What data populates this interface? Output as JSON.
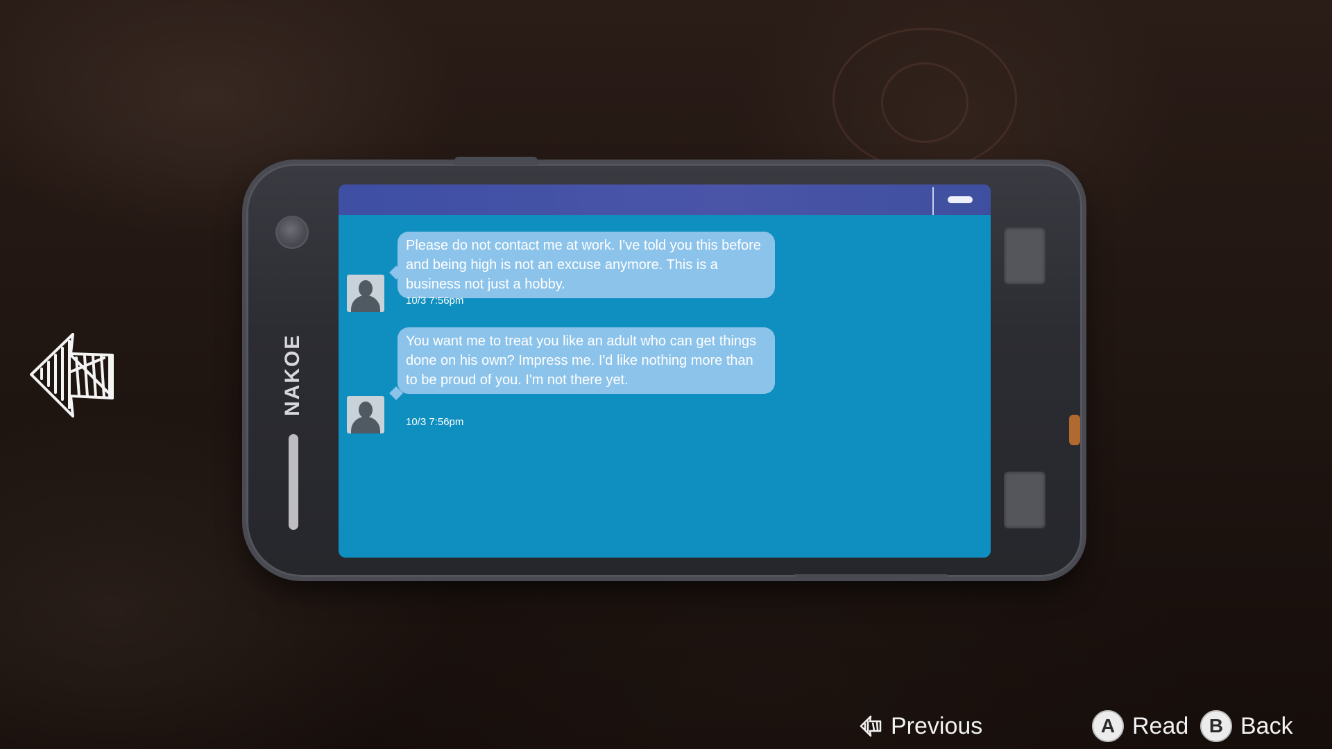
{
  "phone": {
    "brand": "NAKOE"
  },
  "messages": [
    {
      "text": "Please do not contact me at work. I've told you this before and being high is not an excuse anymore. This is a business not just a hobby.",
      "timestamp": "10/3 7:56pm"
    },
    {
      "text": "You want me to treat you like an adult who can get things done on his own? Impress me. I'd like nothing more than to be proud of you. I'm not there yet.",
      "timestamp": "10/3 7:56pm"
    }
  ],
  "controls": {
    "previous_label": "Previous",
    "read_button": "A",
    "read_label": "Read",
    "back_button": "B",
    "back_label": "Back"
  },
  "icons": {
    "left_arrow": "hand-drawn-left-arrow-icon",
    "previous": "hand-drawn-left-arrow-icon"
  }
}
